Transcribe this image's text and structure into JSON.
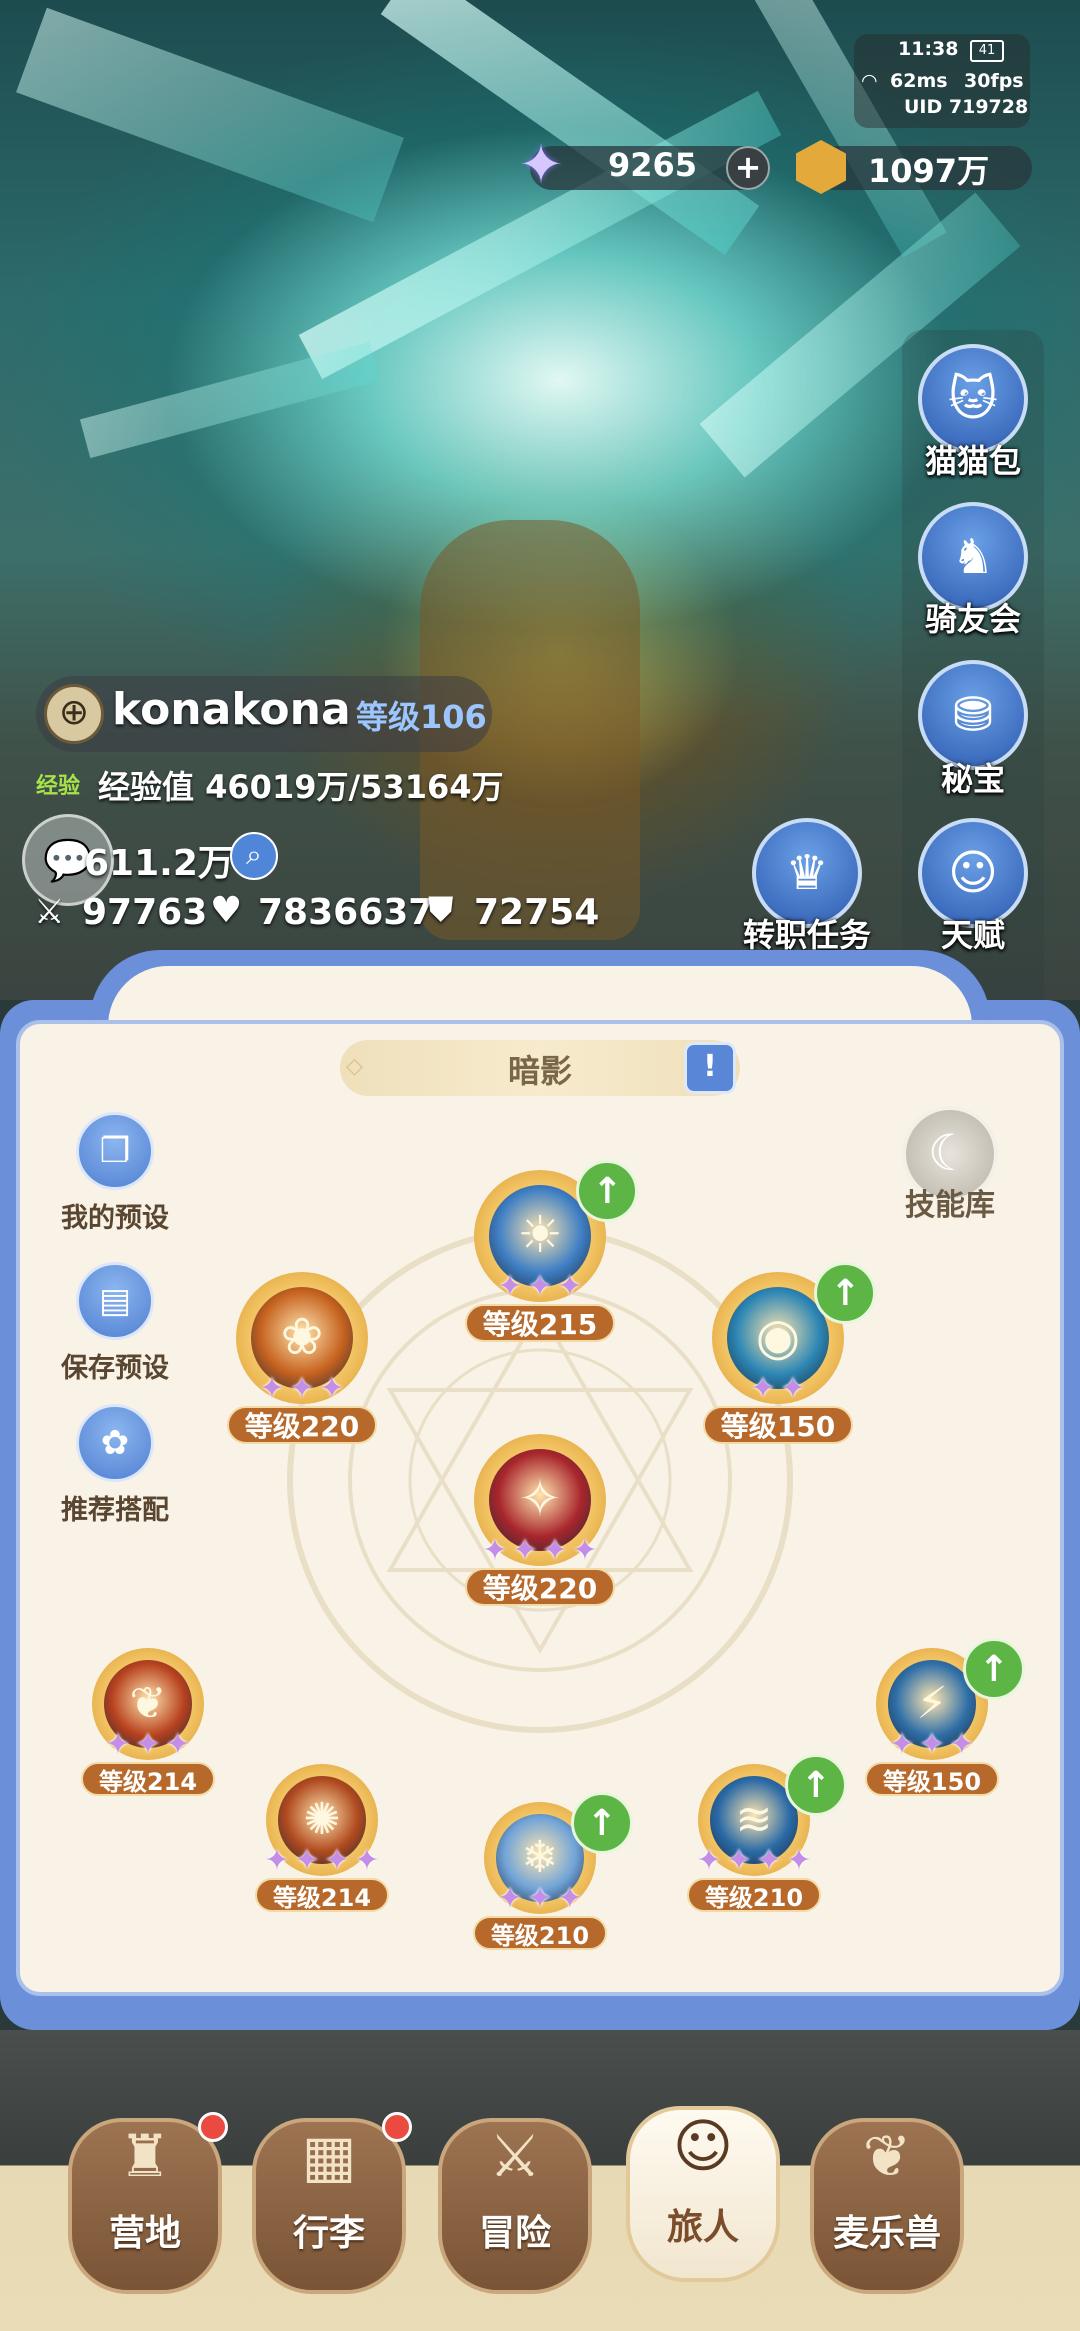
{
  "status": {
    "time": "11:38",
    "ping": "62ms",
    "fps": "30fps",
    "uid": "UID 719728",
    "battery": "41"
  },
  "currency": {
    "gems": "9265",
    "gold": "1097万",
    "add_symbol": "+"
  },
  "right_menu": [
    {
      "label": "猫猫包",
      "icon": "cat-bag-icon"
    },
    {
      "label": "骑友会",
      "icon": "horse-icon"
    },
    {
      "label": "秘宝",
      "icon": "treasure-chest-icon"
    },
    {
      "label": "转职任务",
      "icon": "crown-icon"
    },
    {
      "label": "天赋",
      "icon": "talent-head-icon"
    }
  ],
  "player": {
    "name": "konakona",
    "level_label": "等级106",
    "exp_badge": "经验",
    "exp_text": "经验值 46019万/53164万",
    "power": "611.2万",
    "attack": "97763",
    "hp": "7836637",
    "defense": "72754"
  },
  "panel": {
    "tab_title": "暗影",
    "skill_library": "技能库",
    "side_buttons": [
      {
        "label": "我的预设",
        "icon": "preset-cards-icon"
      },
      {
        "label": "保存预设",
        "icon": "save-icon"
      },
      {
        "label": "推荐搭配",
        "icon": "recommend-icon"
      }
    ],
    "skills": [
      {
        "level": "等级215",
        "stars": 3,
        "upgrade": true,
        "color": "#3f7fc4"
      },
      {
        "level": "等级220",
        "stars": 3,
        "upgrade": false,
        "color": "#c6621f"
      },
      {
        "level": "等级150",
        "stars": 2,
        "upgrade": true,
        "color": "#2c86b4"
      },
      {
        "level": "等级220",
        "stars": 4,
        "upgrade": false,
        "color": "#a8262c"
      },
      {
        "level": "等级214",
        "stars": 3,
        "upgrade": false,
        "color": "#b8421f"
      },
      {
        "level": "等级150",
        "stars": 3,
        "upgrade": true,
        "color": "#2f6fa8"
      },
      {
        "level": "等级214",
        "stars": 4,
        "upgrade": false,
        "color": "#b04a1f"
      },
      {
        "level": "等级210",
        "stars": 3,
        "upgrade": true,
        "color": "#6fa3d8"
      },
      {
        "level": "等级210",
        "stars": 4,
        "upgrade": true,
        "color": "#2a6aa6"
      }
    ]
  },
  "nav": [
    {
      "label": "营地",
      "icon": "castle-icon",
      "badge": true,
      "active": false
    },
    {
      "label": "行李",
      "icon": "backpack-icon",
      "badge": true,
      "active": false
    },
    {
      "label": "冒险",
      "icon": "crossed-swords-icon",
      "badge": false,
      "active": false
    },
    {
      "label": "旅人",
      "icon": "traveler-icon",
      "badge": false,
      "active": true
    },
    {
      "label": "麦乐兽",
      "icon": "fox-icon",
      "badge": false,
      "active": false
    }
  ],
  "colors": {
    "panel_border": "#6b8fd8",
    "panel_bg": "#f8f3e6",
    "level_tag": "#b7682b",
    "upgrade_green": "#5cb545",
    "star_purple": "#c48ee8"
  }
}
